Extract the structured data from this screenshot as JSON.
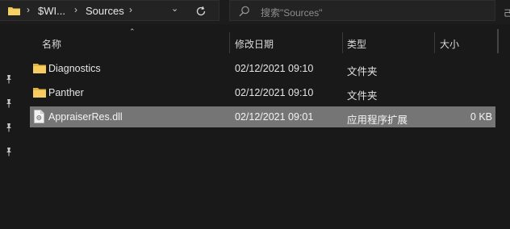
{
  "address": {
    "crumbs": [
      "$WI...",
      "Sources"
    ]
  },
  "search": {
    "placeholder": "搜索\"Sources\""
  },
  "columns": {
    "name": "名称",
    "modified": "修改日期",
    "type": "类型",
    "size": "大小"
  },
  "rows": [
    {
      "name": "Diagnostics",
      "modified": "02/12/2021 09:10",
      "type": "文件夹",
      "size": "",
      "kind": "folder"
    },
    {
      "name": "Panther",
      "modified": "02/12/2021 09:10",
      "type": "文件夹",
      "size": "",
      "kind": "folder"
    },
    {
      "name": "AppraiserRes.dll",
      "modified": "02/12/2021 09:01",
      "type": "应用程序扩展",
      "size": "0 KB",
      "kind": "file",
      "selected": true
    }
  ],
  "edge_glyph": "己",
  "colors": {
    "background": "#191919",
    "selection": "#757575",
    "folder": "#f0c44c"
  },
  "icons": [
    "folder-icon",
    "chevron-right-icon",
    "refresh-icon",
    "search-icon",
    "pin-icon",
    "file-icon"
  ]
}
